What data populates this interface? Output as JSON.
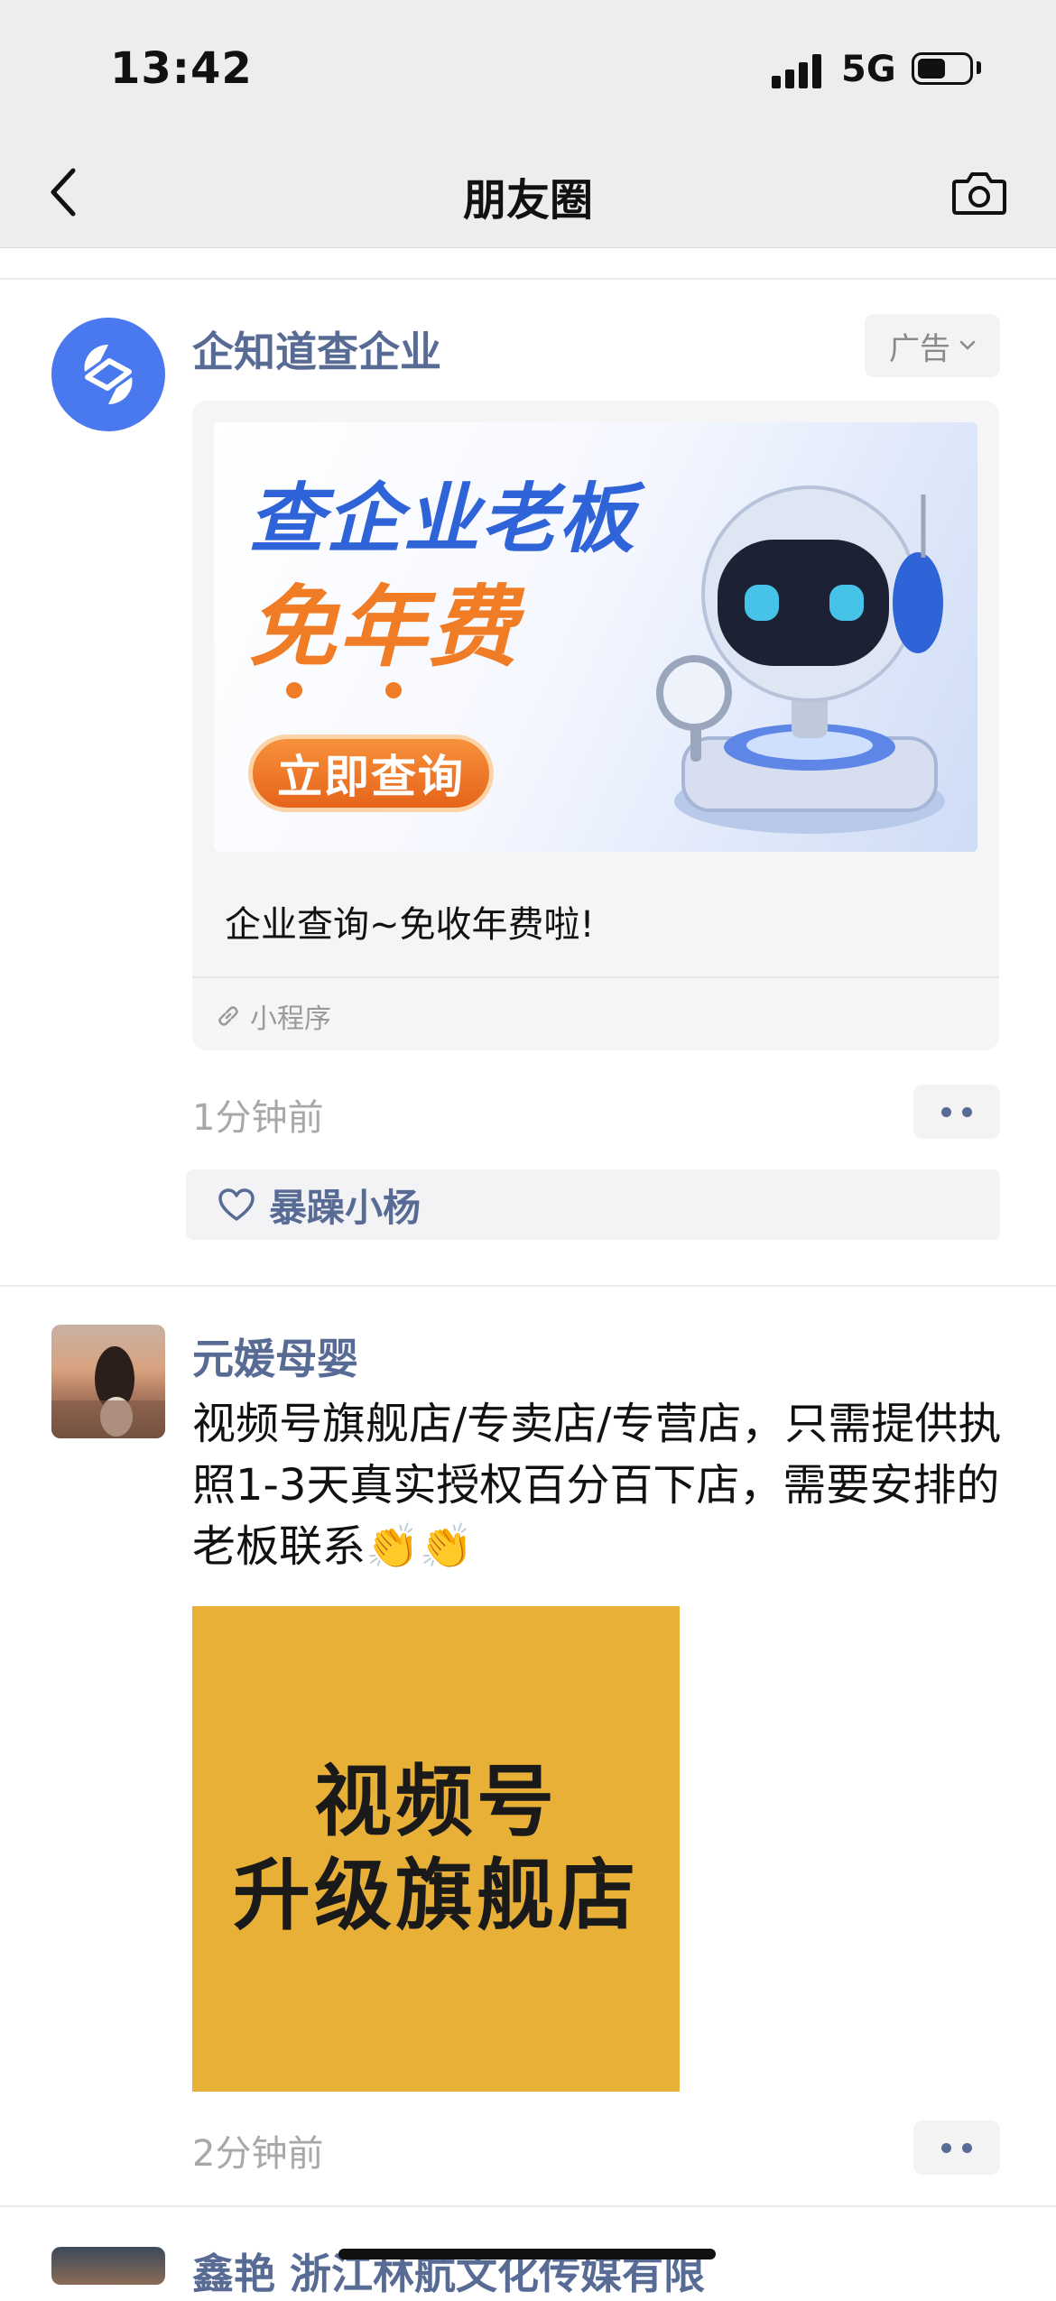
{
  "status_bar": {
    "time": "13:42",
    "network": "5G",
    "battery_level": 0.55
  },
  "nav": {
    "title": "朋友圈",
    "back_icon": "chevron-left-icon",
    "camera_icon": "camera-icon"
  },
  "ad_post": {
    "nickname": "企知道查企业",
    "ad_label": "广告",
    "banner": {
      "headline1": "查企业老板",
      "headline2": "免年费",
      "cta": "立即查询"
    },
    "caption": "企业查询~免收年费啦!",
    "source": "小程序",
    "timestamp": "1分钟前",
    "likes": [
      "暴躁小杨"
    ]
  },
  "post2": {
    "nickname": "元媛母婴",
    "text": "视频号旗舰店/专卖店/专营店，只需提供执照1-3天真实授权百分百下店，需要安排的老板联系👏👏",
    "image_text": [
      "视频号",
      "升级旗舰店"
    ],
    "timestamp": "2分钟前"
  },
  "post3": {
    "nickname": "鑫艳 浙江林航文化传媒有限"
  },
  "colors": {
    "link": "#576b95",
    "accent_blue": "#2f63d8",
    "accent_orange": "#f07d25",
    "image_yellow": "#e9b038"
  }
}
